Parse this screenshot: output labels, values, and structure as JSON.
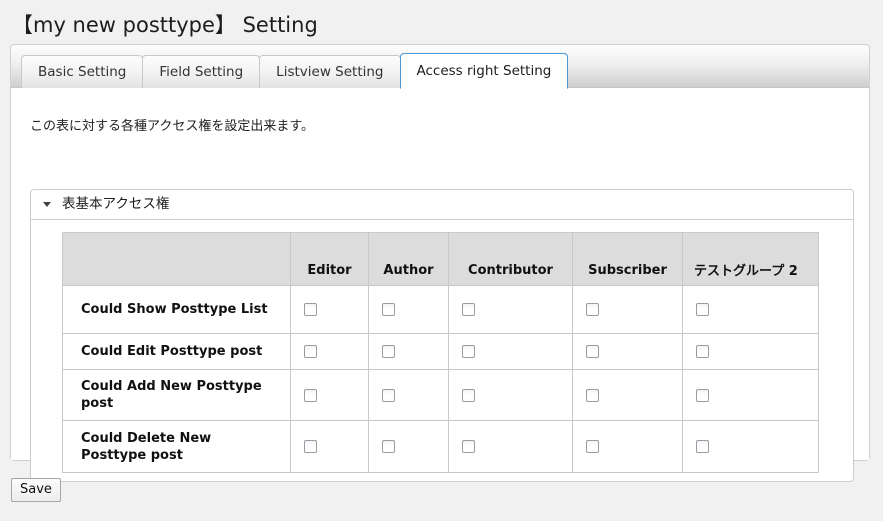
{
  "header": {
    "title": "【my new posttype】 Setting"
  },
  "tabs": [
    {
      "label": "Basic Setting",
      "active": false
    },
    {
      "label": "Field Setting",
      "active": false
    },
    {
      "label": "Listview Setting",
      "active": false
    },
    {
      "label": "Access right Setting",
      "active": true
    }
  ],
  "main": {
    "description": "この表に対する各種アクセス権を設定出来ます。",
    "accordion": {
      "title": "表基本アクセス権",
      "expanded": true,
      "toggle_icon": "triangle-down-icon"
    },
    "table": {
      "columns": [
        {
          "label": "",
          "key": "permission"
        },
        {
          "label": "Editor",
          "key": "editor"
        },
        {
          "label": "Author",
          "key": "author"
        },
        {
          "label": "Contributor",
          "key": "contributor"
        },
        {
          "label": "Subscriber",
          "key": "subscriber"
        },
        {
          "label": "テストグループ 2",
          "key": "test_group_2"
        }
      ],
      "rows": [
        {
          "label": "Could Show Posttype List",
          "checks": [
            false,
            false,
            false,
            false,
            false
          ]
        },
        {
          "label": "Could Edit Posttype post",
          "checks": [
            false,
            false,
            false,
            false,
            false
          ]
        },
        {
          "label": "Could Add New Posttype post",
          "checks": [
            false,
            false,
            false,
            false,
            false
          ]
        },
        {
          "label": "Could Delete New Posttype post",
          "checks": [
            false,
            false,
            false,
            false,
            false
          ]
        }
      ]
    }
  },
  "footer": {
    "save_label": "Save"
  },
  "colors": {
    "page_background": "#f1f1f1",
    "panel_background": "#ffffff",
    "active_tab_border": "#4a9ada",
    "table_header_background": "#dcdcdc",
    "border": "#c8c8c8"
  }
}
